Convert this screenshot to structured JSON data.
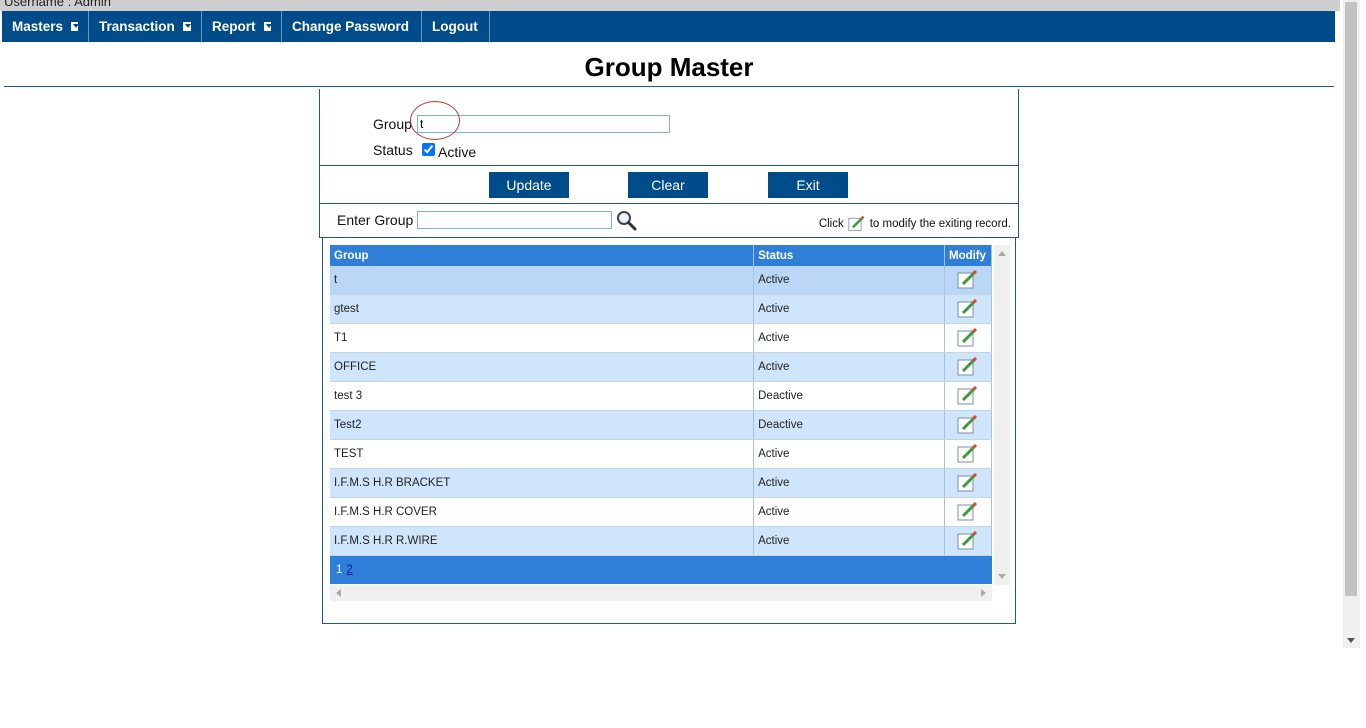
{
  "header": {
    "username": "Username : Admin"
  },
  "nav": {
    "masters": "Masters",
    "transaction": "Transaction",
    "report": "Report",
    "change_password": "Change Password",
    "logout": "Logout"
  },
  "page": {
    "title": "Group Master"
  },
  "form": {
    "group_label": "Group",
    "group_value": "t",
    "status_label": "Status",
    "active_label": "Active",
    "active_checked": true
  },
  "buttons": {
    "update": "Update",
    "clear": "Clear",
    "exit": "Exit"
  },
  "search": {
    "label": "Enter Group",
    "value": "",
    "hint_prefix": "Click",
    "hint_suffix": "to modify the exiting record."
  },
  "grid": {
    "columns": [
      "Group",
      "Status",
      "Modify"
    ],
    "rows": [
      {
        "group": "t",
        "status": "Active"
      },
      {
        "group": "gtest",
        "status": "Active"
      },
      {
        "group": "T1",
        "status": "Active"
      },
      {
        "group": "OFFICE",
        "status": "Active"
      },
      {
        "group": "test 3",
        "status": "Deactive"
      },
      {
        "group": "Test2",
        "status": "Deactive"
      },
      {
        "group": "TEST",
        "status": "Active"
      },
      {
        "group": "I.F.M.S H.R BRACKET",
        "status": "Active"
      },
      {
        "group": "I.F.M.S H.R COVER",
        "status": "Active"
      },
      {
        "group": "I.F.M.S H.R R.WIRE",
        "status": "Active"
      }
    ],
    "pager": {
      "current": "1",
      "next": "2"
    }
  },
  "icons": {
    "edit": "edit-pencil-icon",
    "search": "magnifier-icon"
  },
  "colors": {
    "nav_bg": "#004c8a",
    "grid_header": "#2f7ed8",
    "row_alt": "#cfe5fb"
  }
}
